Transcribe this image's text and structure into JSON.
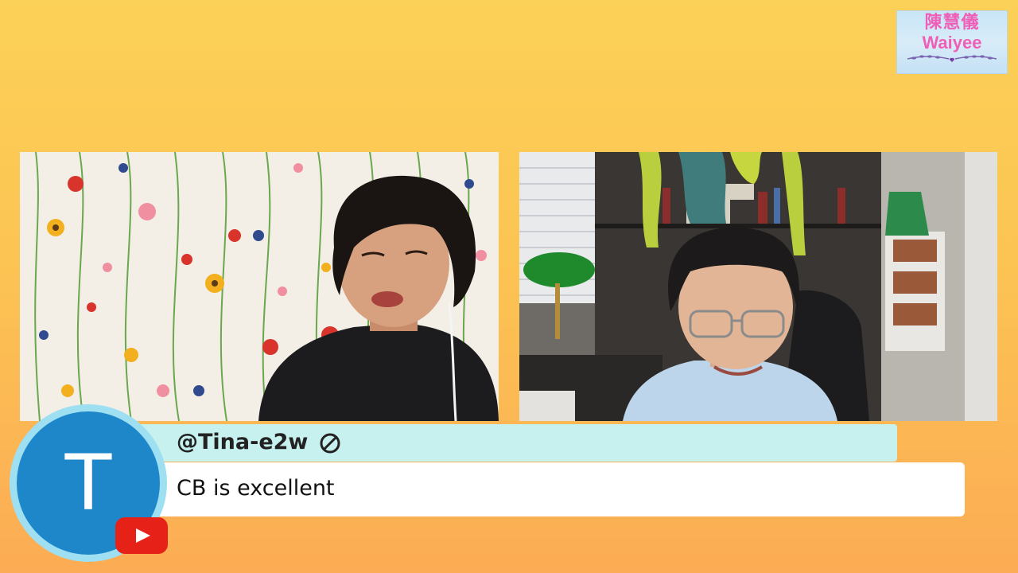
{
  "logo": {
    "chinese_name": "陳慧儀",
    "english_name": "Waiyee"
  },
  "participants": [
    {
      "name": "left-participant",
      "background": "floral-curtain"
    },
    {
      "name": "right-participant",
      "background": "home-office"
    }
  ],
  "chat": {
    "username": "@Tina-e2w",
    "message": "CB is excellent",
    "avatar_letter": "T",
    "badge_icon": "moderator-slash-icon",
    "platform_icon": "youtube-icon"
  },
  "colors": {
    "bg_top": "#fcd157",
    "bg_bottom": "#fcac54",
    "name_bar": "#c6f1ee",
    "avatar": "#1e87c9",
    "youtube_red": "#e62117",
    "logo_pink": "#ef5fb7"
  }
}
